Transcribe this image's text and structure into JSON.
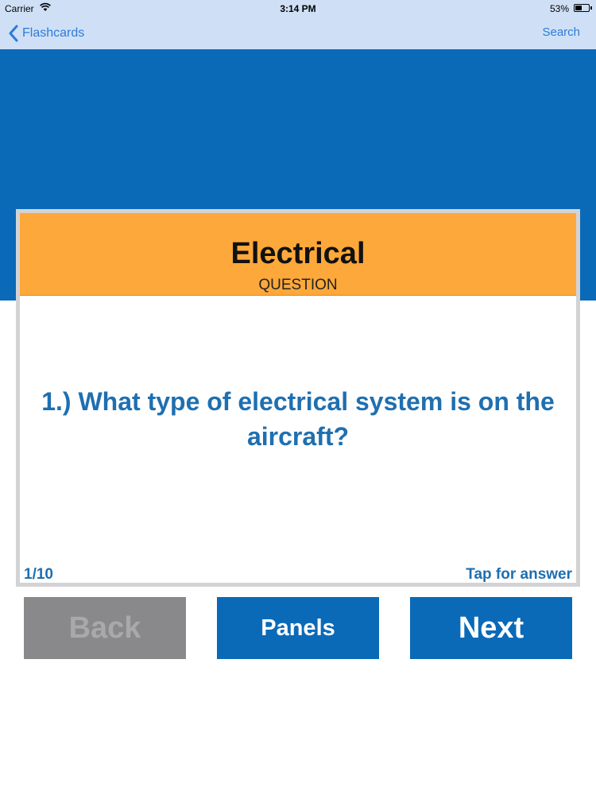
{
  "status_bar": {
    "carrier": "Carrier",
    "time": "3:14 PM",
    "battery_percent": "53%",
    "battery_level": 0.53,
    "wifi_icon": "wifi-icon",
    "battery_icon": "battery-icon"
  },
  "nav": {
    "back_label": "Flashcards",
    "back_icon": "chevron-left-icon",
    "search_label": "Search"
  },
  "card": {
    "title": "Electrical",
    "subtitle": "QUESTION",
    "question": "1.) What type of electrical system is on the aircraft?",
    "counter": "1/10",
    "tap_hint": "Tap for answer"
  },
  "buttons": {
    "back": "Back",
    "panels": "Panels",
    "next": "Next"
  },
  "colors": {
    "nav_background": "#cfe0f6",
    "primary_blue": "#0a6ab8",
    "header_orange": "#fda83a",
    "text_blue": "#1f6fb0",
    "disabled_gray": "#89898b"
  }
}
